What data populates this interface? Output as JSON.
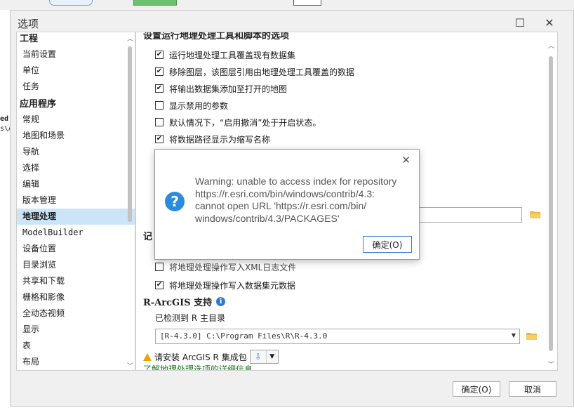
{
  "background": {
    "side_text_1": "ed",
    "side_text_2": "s\\A"
  },
  "window": {
    "title": "选项",
    "maximize_glyph": "☐",
    "close_glyph": "✕"
  },
  "nav": {
    "group1": "工程",
    "group1_items": [
      "当前设置",
      "单位",
      "任务"
    ],
    "group2": "应用程序",
    "group2_items": [
      "常规",
      "地图和场景",
      "导航",
      "选择",
      "编辑",
      "版本管理",
      "地理处理",
      "ModelBuilder",
      "设备位置",
      "目录浏览",
      "共享和下载",
      "栅格和影像",
      "全动态视频",
      "显示",
      "表",
      "布局"
    ],
    "selected": "地理处理"
  },
  "content": {
    "section1_title": "设置运行地理处理工具和脚本的选项",
    "options": [
      {
        "label": "运行地理处理工具覆盖现有数据集",
        "checked": true
      },
      {
        "label": "移除图层，该图层引用由地理处理工具覆盖的数据",
        "checked": true
      },
      {
        "label": "将输出数据集添加至打开的地图",
        "checked": true
      },
      {
        "label": "显示禁用的参数",
        "checked": false
      },
      {
        "label": "默认情况下，“启用撤消”处于开启状态。",
        "checked": false
      },
      {
        "label": "将数据路径显示为缩写名称",
        "checked": true
      }
    ],
    "section2_partial": "记",
    "hidden_option_partial": "将地理处理操作写入XML日志文件",
    "log_option": {
      "label": "将地理处理操作写入数据集元数据",
      "checked": true
    },
    "r_title": "R-ArcGIS 支持",
    "r_detected": "已检测到 R 主目录",
    "r_home_value": "[R-4.3.0] C:\\Program Files\\R\\R-4.3.0",
    "install_text": "请安装 ArcGIS R 集成包",
    "learn_more_link": "了解地理处理选项的详细信息"
  },
  "buttons": {
    "ok": "确定(O)",
    "cancel": "取消"
  },
  "message_box": {
    "lines": [
      "Warning: unable to access index for repository",
      "https://r.esri.com/bin/windows/contrib/4.3:",
      "cannot open URL 'https://r.esri.com/bin/",
      "windows/contrib/4.3/PACKAGES'"
    ],
    "ok_label": "确定(O)",
    "close_glyph": "✕",
    "icon_glyph": "?"
  },
  "colors": {
    "selected_bg": "#cce4f7",
    "info_blue": "#2b8be0",
    "link_green": "#1a7a1a",
    "warn_orange": "#e8a400"
  }
}
